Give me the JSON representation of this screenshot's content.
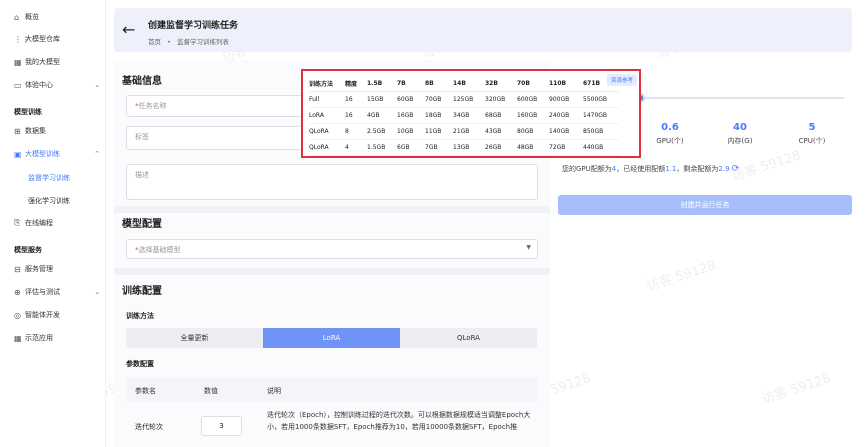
{
  "sidebar": {
    "items": [
      {
        "label": "概览",
        "icon": "home-icon"
      },
      {
        "label": "大模型仓库",
        "icon": "grid-icon"
      },
      {
        "label": "我的大模型",
        "icon": "apps-icon"
      },
      {
        "label": "体验中心",
        "icon": "chat-icon"
      }
    ],
    "section_train": "模型训练",
    "train_items": [
      {
        "label": "数据集",
        "icon": "dataset-icon"
      },
      {
        "label": "大模型训练",
        "icon": "train-icon"
      }
    ],
    "train_sub": [
      "监督学习训练",
      "强化学习训练"
    ],
    "online_coding": "在线编程",
    "section_service": "模型服务",
    "service_items": [
      {
        "label": "服务管理",
        "icon": "server-icon"
      },
      {
        "label": "评估与测试",
        "icon": "eval-icon"
      },
      {
        "label": "智能体开发",
        "icon": "agent-icon"
      },
      {
        "label": "示范应用",
        "icon": "demo-icon"
      }
    ]
  },
  "header": {
    "title": "创建监督学习训练任务",
    "breadcrumb": [
      "首页",
      "•",
      "监督学习训练列表"
    ]
  },
  "basic": {
    "title": "基础信息",
    "task_name_placeholder": "任务名称",
    "tags_placeholder": "标签",
    "desc_placeholder": "描述"
  },
  "model_config": {
    "title": "模型配置",
    "base_model_placeholder": "选择基础模型"
  },
  "train_config": {
    "title": "训练配置",
    "method_label": "训练方法",
    "methods": [
      "全量更新",
      "LoRA",
      "QLoRA"
    ],
    "params_label": "参数配置",
    "param_headers": [
      "参数名",
      "数值",
      "说明"
    ],
    "param_row": {
      "name": "迭代轮次",
      "value": "3",
      "desc": "迭代轮次（Epoch），控制训练过程的迭代次数。可以根据数据规模适当调整Epoch大小，若用1000条数据SFT，Epoch推荐为10，若用10000条数据SFT，Epoch推"
    }
  },
  "resource": {
    "tag": "资源参考",
    "headers": [
      "训练方法",
      "精度",
      "1.5B",
      "7B",
      "8B",
      "14B",
      "32B",
      "70B",
      "110B",
      "671B"
    ],
    "rows": [
      [
        "Full",
        "16",
        "15GB",
        "60GB",
        "70GB",
        "125GB",
        "320GB",
        "600GB",
        "900GB",
        "5500GB"
      ],
      [
        "LoRA",
        "16",
        "4GB",
        "16GB",
        "18GB",
        "34GB",
        "68GB",
        "160GB",
        "240GB",
        "1470GB"
      ],
      [
        "QLoRA",
        "8",
        "2.5GB",
        "10GB",
        "11GB",
        "21GB",
        "43GB",
        "80GB",
        "140GB",
        "850GB"
      ],
      [
        "QLoRA",
        "4",
        "1.5GB",
        "6GB",
        "7GB",
        "13GB",
        "26GB",
        "48GB",
        "72GB",
        "440GB"
      ]
    ]
  },
  "resources_panel": {
    "slider_fraction": 0.15,
    "stats": [
      {
        "value": "8",
        "label": "G)"
      },
      {
        "value": "0.6",
        "label": "GPU(个)"
      },
      {
        "value": "40",
        "label": "内存(G)"
      },
      {
        "value": "5",
        "label": "CPU(个)"
      }
    ],
    "quota_prefix": "您的GPU配额为",
    "quota_total": "4",
    "quota_mid": "，已经使用配额",
    "quota_used": "1.1",
    "quota_mid2": "，剩余配额为",
    "quota_left": "2.9",
    "run_button": "创建并运行任务"
  },
  "watermark": "访客 59128",
  "colors": {
    "accent": "#4a7cf6",
    "highlight_border": "#e0303b"
  }
}
